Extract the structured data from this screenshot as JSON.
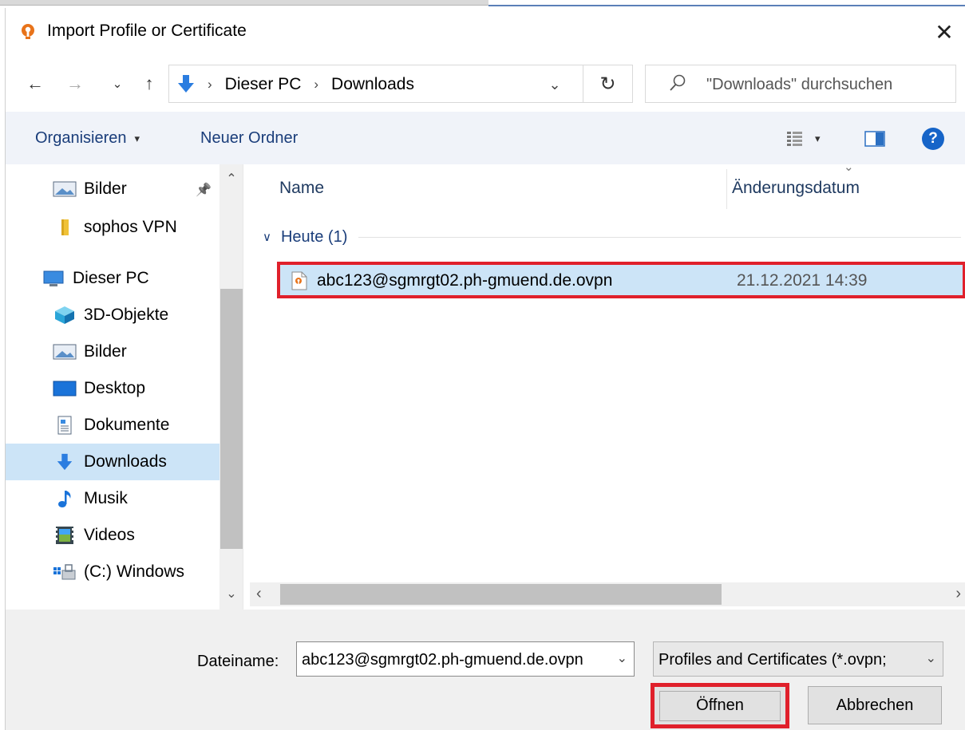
{
  "dialog": {
    "title": "Import Profile or Certificate",
    "close_glyph": "✕"
  },
  "navigation": {
    "back_glyph": "←",
    "forward_glyph": "→",
    "recent_glyph": "⌄",
    "up_glyph": "↑",
    "breadcrumb": [
      "Dieser PC",
      "Downloads"
    ],
    "crumb_separator": "›",
    "address_dropdown_glyph": "⌄",
    "refresh_glyph": "↻",
    "search_placeholder": "\"Downloads\" durchsuchen"
  },
  "toolbar": {
    "organize_label": "Organisieren",
    "organize_caret": "▾",
    "new_folder_label": "Neuer Ordner",
    "help_label": "?"
  },
  "sidebar": {
    "pin_glyph": "📌",
    "items": [
      {
        "label": "Bilder",
        "icon": "pictures-icon"
      },
      {
        "label": "sophos VPN",
        "icon": "folder-icon"
      },
      {
        "label": "Dieser PC",
        "icon": "computer-icon"
      },
      {
        "label": "3D-Objekte",
        "icon": "3d-objects-icon"
      },
      {
        "label": "Bilder",
        "icon": "pictures-icon"
      },
      {
        "label": "Desktop",
        "icon": "desktop-icon"
      },
      {
        "label": "Dokumente",
        "icon": "documents-icon"
      },
      {
        "label": "Downloads",
        "icon": "downloads-icon"
      },
      {
        "label": "Musik",
        "icon": "music-icon"
      },
      {
        "label": "Videos",
        "icon": "videos-icon"
      },
      {
        "label": "(C:) Windows",
        "icon": "drive-icon"
      }
    ]
  },
  "file_list": {
    "columns": [
      "Name",
      "Änderungsdatum"
    ],
    "group_label": "Heute (1)",
    "files": [
      {
        "name": "abc123@sgmrgt02.ph-gmuend.de.ovpn",
        "modified": "21.12.2021 14:39"
      }
    ]
  },
  "footer": {
    "filename_label": "Dateiname:",
    "filename_value": "abc123@sgmrgt02.ph-gmuend.de.ovpn",
    "filter_value": "Profiles and Certificates (*.ovpn;",
    "open_label": "Öffnen",
    "cancel_label": "Abbrechen"
  },
  "colors": {
    "accent_blue": "#1664c8",
    "selection": "#cce4f7",
    "highlight_red": "#e0202b",
    "openvpn_orange": "#e8731a"
  }
}
